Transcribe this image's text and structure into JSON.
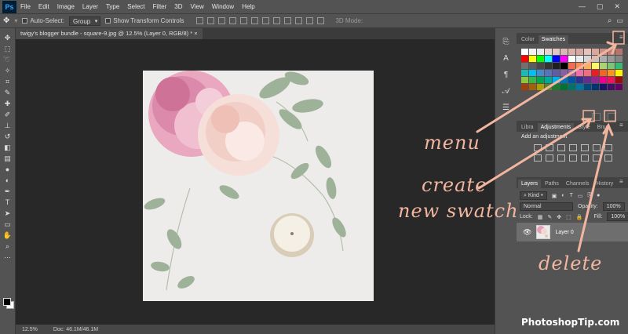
{
  "app": {
    "logo": "Ps"
  },
  "menubar": {
    "items": [
      "File",
      "Edit",
      "Image",
      "Layer",
      "Type",
      "Select",
      "Filter",
      "3D",
      "View",
      "Window",
      "Help"
    ],
    "window_controls": [
      "—",
      "▢",
      "✕"
    ]
  },
  "options": {
    "auto_select_label": "Auto-Select:",
    "auto_select_value": "Group",
    "show_transform_label": "Show Transform Controls",
    "mode_3d_label": "3D Mode:"
  },
  "document": {
    "tab_title": "twigy's blogger bundle - square-9.jpg @ 12.5% (Layer 0, RGB/8) *",
    "zoom": "12.5%",
    "doc_size": "Doc: 46.1M/46.1M"
  },
  "swatches_panel": {
    "tabs": [
      "Color",
      "Swatches"
    ],
    "active_tab": "Swatches"
  },
  "adjustments_panel": {
    "tabs": [
      "Libra",
      "Adjustments",
      "Style",
      "Brus"
    ],
    "active_tab": "Adjustments",
    "heading": "Add an adjustment"
  },
  "layers_panel": {
    "tabs": [
      "Layers",
      "Paths",
      "Channels",
      "History"
    ],
    "active_tab": "Layers",
    "kind_label": "Kind",
    "blend_mode": "Normal",
    "opacity_label": "Opacity:",
    "opacity_value": "100%",
    "lock_label": "Lock:",
    "fill_label": "Fill:",
    "fill_value": "100%",
    "layer_name": "Layer 0"
  },
  "annotations": {
    "menu": "menu",
    "create_line1": "create",
    "create_line2": "new swatch",
    "delete": "delete"
  },
  "watermark": "PhotoshopTip.com",
  "colors": {
    "annotation": "#f2b6a0",
    "ps_brand": "#31a8ff"
  }
}
